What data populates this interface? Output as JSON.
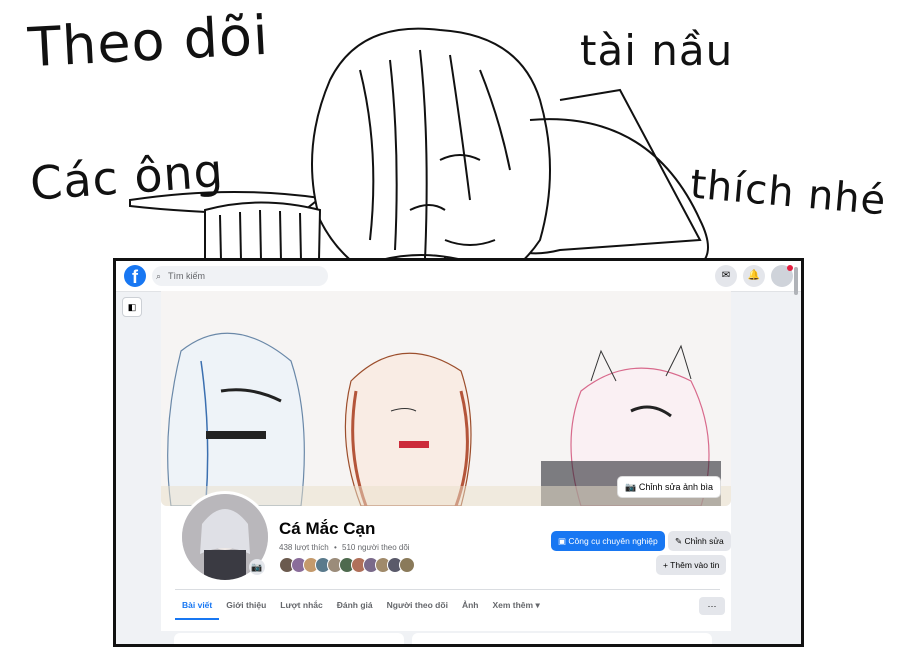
{
  "handwriting": {
    "line1": "Theo dõi",
    "line2": "tài nầu",
    "line3": "Các ông",
    "line4": "thích nhé"
  },
  "topbar": {
    "logo": "f",
    "search_placeholder": "Tìm kiếm",
    "icons": [
      "messenger-icon",
      "bell-icon",
      "avatar"
    ]
  },
  "cover": {
    "edit_cover_label": "Chỉnh sửa ảnh bìa"
  },
  "profile": {
    "name": "Cá Mắc Cạn",
    "likes": "438 lượt thích",
    "followers": "510 người theo dõi",
    "separator": "•"
  },
  "actions": {
    "pro_tools": "Công cụ chuyên nghiệp",
    "edit": "Chỉnh sửa",
    "add_story": "+ Thêm vào tin"
  },
  "tabs": [
    {
      "label": "Bài viết",
      "active": true
    },
    {
      "label": "Giới thiệu",
      "active": false
    },
    {
      "label": "Lượt nhắc",
      "active": false
    },
    {
      "label": "Đánh giá",
      "active": false
    },
    {
      "label": "Người theo dõi",
      "active": false
    },
    {
      "label": "Ảnh",
      "active": false
    },
    {
      "label": "Xem thêm ▾",
      "active": false
    }
  ],
  "more_button": "···",
  "colors": {
    "brand": "#1877f2",
    "friend_avatars": [
      "#6b5a4e",
      "#8a6d9a",
      "#c49a6c",
      "#5a7a8c",
      "#9b8c7a",
      "#4e6a4e",
      "#b0705a",
      "#7a6a8a",
      "#a08a6a",
      "#5a5a6a",
      "#8a7a5a"
    ]
  }
}
